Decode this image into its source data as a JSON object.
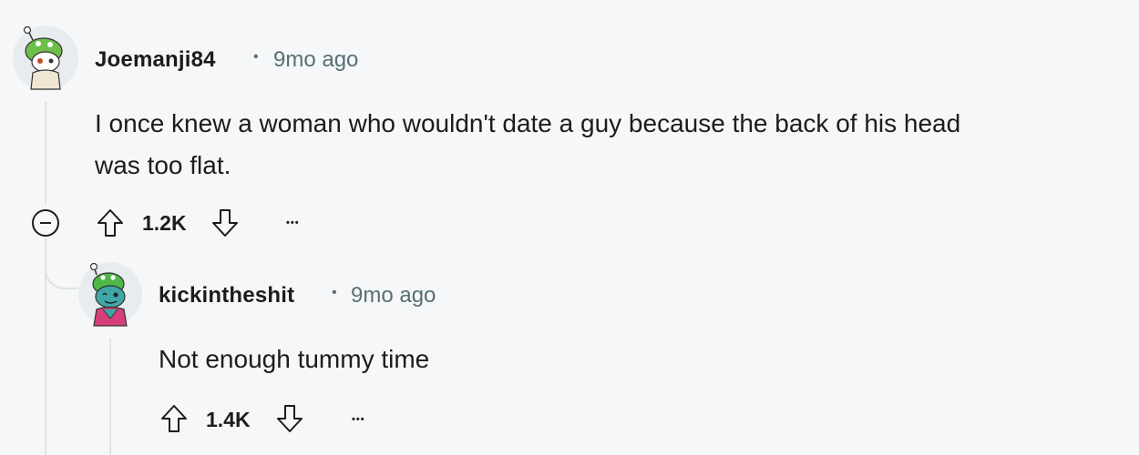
{
  "comments": [
    {
      "username": "Joemanji84",
      "separator": "•",
      "time": "9mo ago",
      "body_lines": [
        "I once knew a woman who wouldn't date a guy because the back of his head",
        "was too flat."
      ],
      "votes": "1.2K",
      "more": "•••",
      "avatar": "snoo-avatar-green-hat"
    },
    {
      "username": "kickintheshit",
      "separator": "•",
      "time": "9mo ago",
      "body_lines": [
        "Not enough tummy time"
      ],
      "votes": "1.4K",
      "more": "•••",
      "avatar": "snoo-avatar-teal-face"
    }
  ],
  "colors": {
    "background": "#f6f7f8",
    "text": "#1c1c1c",
    "meta": "#576f76",
    "thread_line": "#dfe3e6"
  },
  "icons": [
    "upvote-icon",
    "downvote-icon",
    "collapse-icon",
    "more-icon"
  ]
}
